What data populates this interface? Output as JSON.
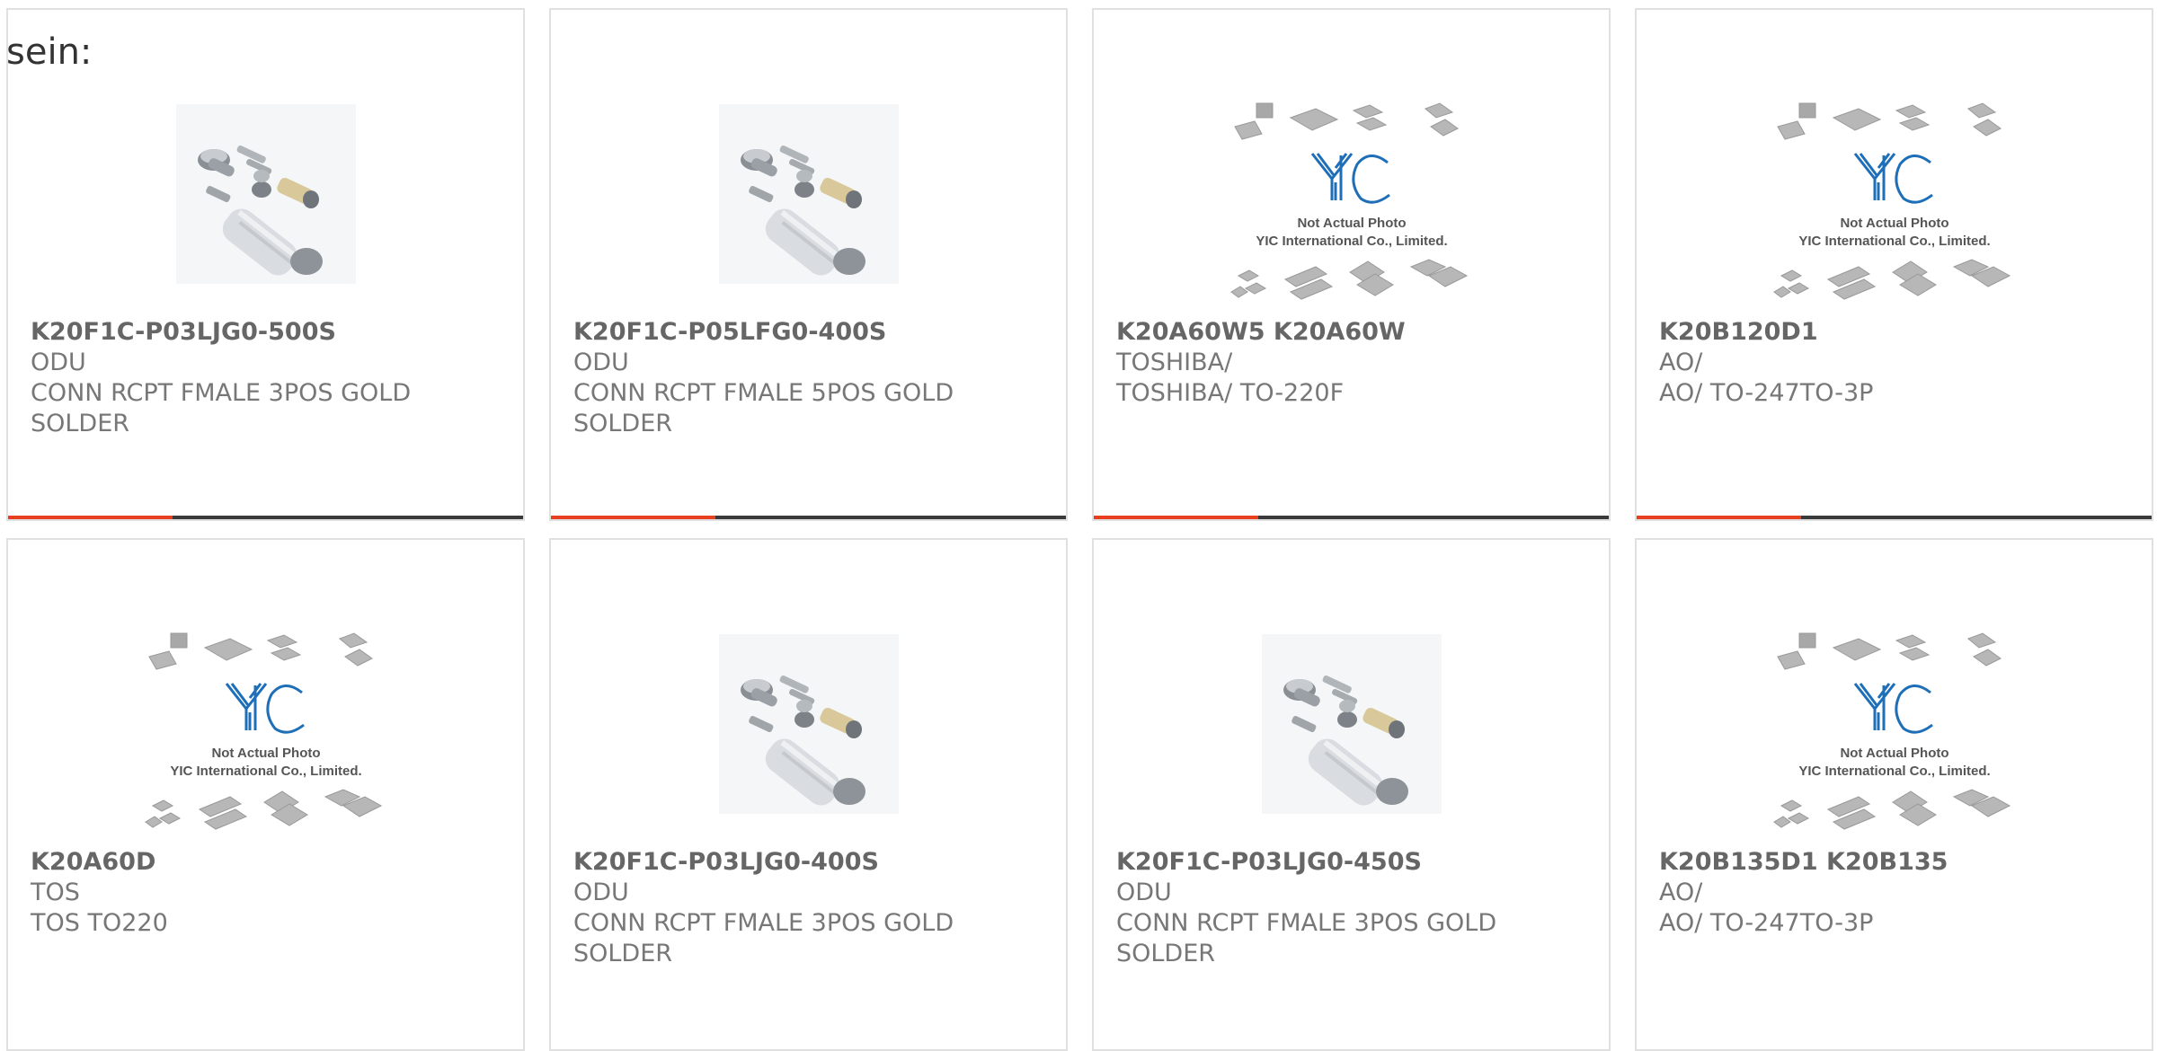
{
  "intro_text": "sein:",
  "placeholder_image": {
    "line1": "Not Actual Photo",
    "line2": "YIC International Co., Limited."
  },
  "colors": {
    "accent": "#e83f1f",
    "bar": "#3a3a3a",
    "border": "#e0e0e0",
    "text": "#777777"
  },
  "products": [
    {
      "part": "K20F1C-P03LJG0-500S",
      "manufacturer": "ODU",
      "description": "CONN RCPT FMALE 3POS GOLD SOLDER",
      "image": "connector-photo"
    },
    {
      "part": "K20F1C-P05LFG0-400S",
      "manufacturer": "ODU",
      "description": "CONN RCPT FMALE 5POS GOLD SOLDER",
      "image": "connector-photo"
    },
    {
      "part": "K20A60W5 K20A60W",
      "manufacturer": "TOSHIBA/",
      "description": "TOSHIBA/ TO-220F",
      "image": "yic-placeholder"
    },
    {
      "part": "K20B120D1",
      "manufacturer": "AO/",
      "description": "AO/ TO-247TO-3P",
      "image": "yic-placeholder"
    },
    {
      "part": "K20A60D",
      "manufacturer": "TOS",
      "description": "TOS TO220",
      "image": "yic-placeholder"
    },
    {
      "part": "K20F1C-P03LJG0-400S",
      "manufacturer": "ODU",
      "description": "CONN RCPT FMALE 3POS GOLD SOLDER",
      "image": "connector-photo"
    },
    {
      "part": "K20F1C-P03LJG0-450S",
      "manufacturer": "ODU",
      "description": "CONN RCPT FMALE 3POS GOLD SOLDER",
      "image": "connector-photo"
    },
    {
      "part": "K20B135D1 K20B135",
      "manufacturer": "AO/",
      "description": "AO/ TO-247TO-3P",
      "image": "yic-placeholder"
    }
  ]
}
